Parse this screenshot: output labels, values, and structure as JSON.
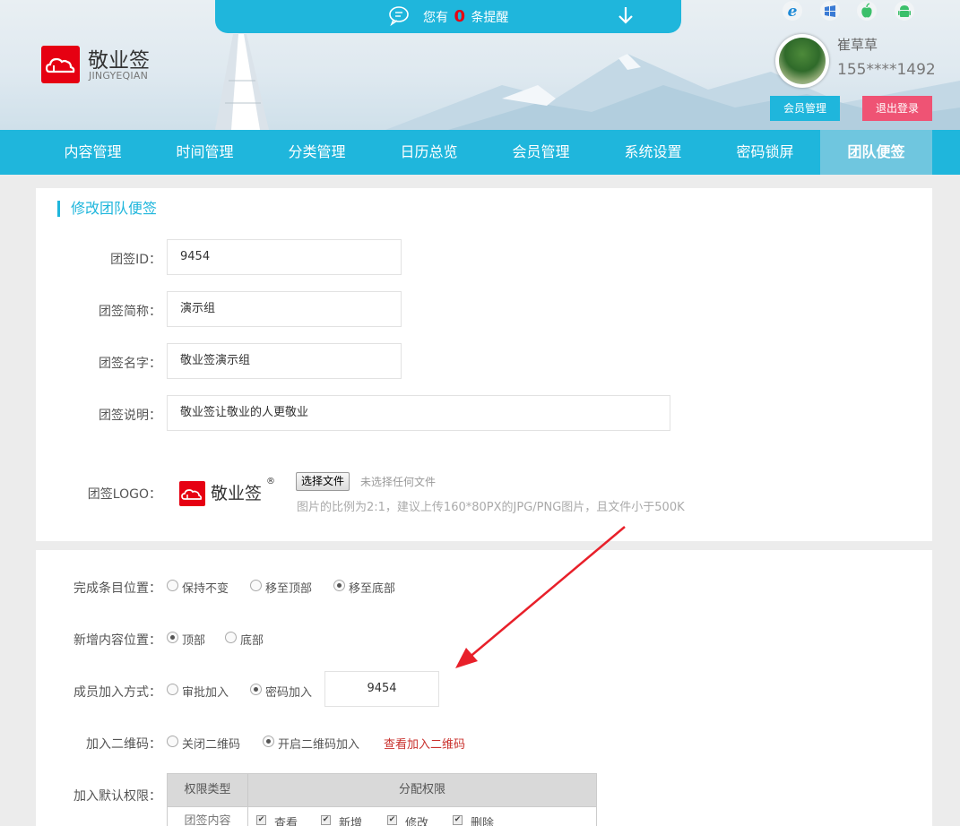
{
  "notice": {
    "prefix": "您有",
    "count": "0",
    "suffix": "条提醒"
  },
  "brand": {
    "name": "敬业签",
    "sub": "JINGYEQIAN"
  },
  "user": {
    "name": "崔草草",
    "phone": "155****1492",
    "member_btn": "会员管理",
    "logout_btn": "退出登录"
  },
  "platform_icons": [
    "ie-icon",
    "windows-icon",
    "apple-icon",
    "android-icon"
  ],
  "nav": {
    "items": [
      {
        "label": "内容管理"
      },
      {
        "label": "时间管理"
      },
      {
        "label": "分类管理"
      },
      {
        "label": "日历总览"
      },
      {
        "label": "会员管理"
      },
      {
        "label": "系统设置"
      },
      {
        "label": "密码锁屏"
      },
      {
        "label": "团队便签"
      }
    ],
    "active_index": 7
  },
  "form": {
    "title": "修改团队便签",
    "id_label": "团签ID：",
    "id_value": "9454",
    "short_label": "团签简称：",
    "short_value": "演示组",
    "name_label": "团签名字：",
    "name_value": "敬业签演示组",
    "desc_label": "团签说明：",
    "desc_value": "敬业签让敬业的人更敬业",
    "logo_label": "团签LOGO：",
    "logo_text": "敬业签",
    "logo_reg": "®",
    "file_btn": "选择文件",
    "file_none": "未选择任何文件",
    "file_hint": "图片的比例为2:1，建议上传160*80PX的JPG/PNG图片，且文件小于500K"
  },
  "settings": {
    "complete_label": "完成条目位置：",
    "complete_options": [
      "保持不变",
      "移至顶部",
      "移至底部"
    ],
    "complete_selected": 2,
    "new_label": "新增内容位置：",
    "new_options": [
      "顶部",
      "底部"
    ],
    "new_selected": 0,
    "join_label": "成员加入方式：",
    "join_options": [
      "审批加入",
      "密码加入"
    ],
    "join_selected": 1,
    "join_password": "9454",
    "qr_label": "加入二维码：",
    "qr_options": [
      "关闭二维码",
      "开启二维码加入"
    ],
    "qr_selected": 1,
    "qr_link": "查看加入二维码",
    "perm_label": "加入默认权限：",
    "perm_headers": [
      "权限类型",
      "分配权限"
    ],
    "perm_row_type": "团签内容",
    "perm_items": [
      "查看",
      "新增",
      "修改",
      "删除"
    ]
  }
}
